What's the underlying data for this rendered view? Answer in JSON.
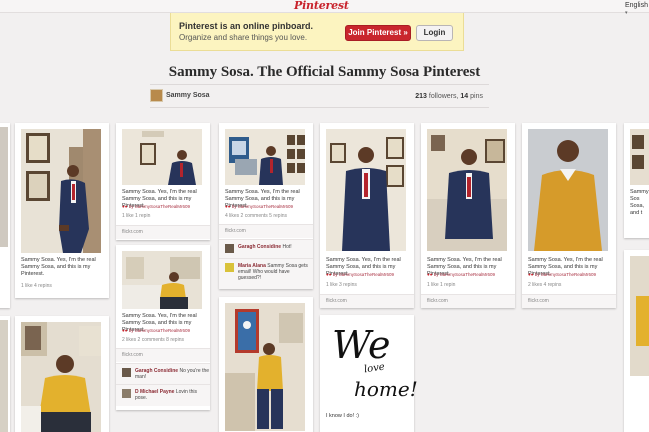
{
  "header": {
    "logo": "Pinterest",
    "language": "English",
    "language_caret": "▾"
  },
  "banner": {
    "headline": "Pinterest is an online pinboard.",
    "subline": "Organize and share things you love.",
    "join_label": "Join Pinterest »",
    "login_label": "Login"
  },
  "board": {
    "title": "Sammy Sosa. The Official Sammy Sosa Pinterest",
    "username": "Sammy Sosa",
    "followers": "213",
    "followers_label": "followers,",
    "pins": "14",
    "pins_label": "pins"
  },
  "pins": {
    "p2": {
      "desc": "Sammy Sosa. Yes, I'm the real Sammy Sosa, and this is my Pinterest.",
      "counts": "1 like   4 repins"
    },
    "p3": {
      "desc": "Sammy Sosa. Yes, I'm the real Sammy Sosa, and this is my Pinterest.",
      "via": "by SammySosaTheRealMr609",
      "counts": "1 like   1 repin",
      "source": "flickr.com"
    },
    "p3b": {
      "desc": "Sammy Sosa. Yes, I'm the real Sammy Sosa, and this is my Pinterest.",
      "via": "by SammySosaTheRealMr609",
      "counts": "2 likes   2 comments   8 repins",
      "source": "flickr.com",
      "comment1_name": "Garagh Considine",
      "comment1_text": "No you're the man!",
      "comment2_name": "D Michael Payne",
      "comment2_text": "Lovin this pose."
    },
    "p4": {
      "desc": "Sammy Sosa. Yes, I'm the real Sammy Sosa, and this is my Pinterest.",
      "via": "by SammySosaTheRealMr609",
      "counts": "4 likes   2 comments   5 repins",
      "source": "flickr.com",
      "comment1_name": "Garagh Considine",
      "comment1_text": "Hot!",
      "comment2_name": "Maria Alana",
      "comment2_text": "Sammy Sosa gets email! Who would have guessed?!"
    },
    "p5": {
      "desc": "Sammy Sosa. Yes, I'm the real Sammy Sosa, and this is my Pinterest.",
      "via": "by SammySosaTheRealMr609",
      "counts": "1 like   3 repins",
      "source": "flickr.com"
    },
    "p5b": {
      "caption": "I know I do! :)",
      "art_line1": "We",
      "art_line2": "love",
      "art_line3": "home!"
    },
    "p6": {
      "desc": "Sammy Sosa. Yes, I'm the real Sammy Sosa, and this is my Pinterest.",
      "via": "by SammySosaTheRealMr609",
      "counts": "1 like   1 repin",
      "source": "flickr.com"
    },
    "p7": {
      "desc": "Sammy Sosa. Yes, I'm the real Sammy Sosa, and this is my Pinterest.",
      "via": "by SammySosaTheRealMr609",
      "counts": "2 likes   4 repins",
      "source": "flickr.com"
    },
    "p8": {
      "desc_partial": "Sammy Sos Sosa, and t"
    }
  }
}
